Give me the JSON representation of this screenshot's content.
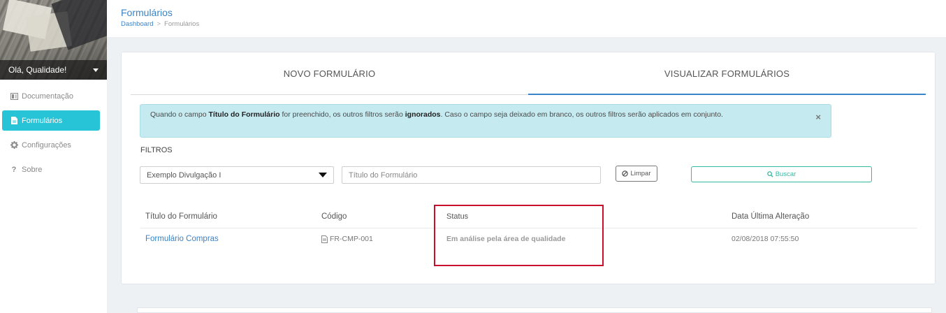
{
  "sidebar": {
    "greeting": "Olá, Qualidade!",
    "items": [
      {
        "label": "Documentação",
        "icon": "book-icon"
      },
      {
        "label": "Formulários",
        "icon": "file-icon"
      },
      {
        "label": "Configurações",
        "icon": "gear-icon"
      },
      {
        "label": "Sobre",
        "icon": "question-icon"
      }
    ]
  },
  "header": {
    "title": "Formulários",
    "breadcrumb": {
      "home": "Dashboard",
      "separator": ">",
      "current": "Formulários"
    }
  },
  "tabs": [
    {
      "label": "NOVO FORMULÁRIO",
      "active": false
    },
    {
      "label": "VISUALIZAR FORMULÁRIOS",
      "active": true
    }
  ],
  "alert": {
    "text_1": "Quando o campo ",
    "bold_1": "Título do Formulário",
    "text_2": " for preenchido, os outros filtros serão ",
    "bold_2": "ignorados",
    "text_3": ". Caso o campo seja deixado em branco, os outros filtros serão aplicados em conjunto.",
    "close": "×"
  },
  "filters": {
    "label": "FILTROS",
    "select_value": "Exemplo Divulgação I",
    "title_placeholder": "Título do Formulário",
    "clear_label": "Limpar",
    "search_label": "Buscar"
  },
  "table": {
    "columns": [
      "Título do Formulário",
      "Código",
      "Status",
      "Data Última Alteração"
    ],
    "rows": [
      {
        "title": "Formulário Compras",
        "code": "FR-CMP-001",
        "status": "Em análise pela área de qualidade",
        "date": "02/08/2018 07:55:50"
      }
    ]
  },
  "colors": {
    "accent": "#27c3d6",
    "link": "#3a84c7",
    "alert_bg": "#c5eaf0",
    "search": "#33b8a3",
    "highlight": "#c8102e"
  }
}
